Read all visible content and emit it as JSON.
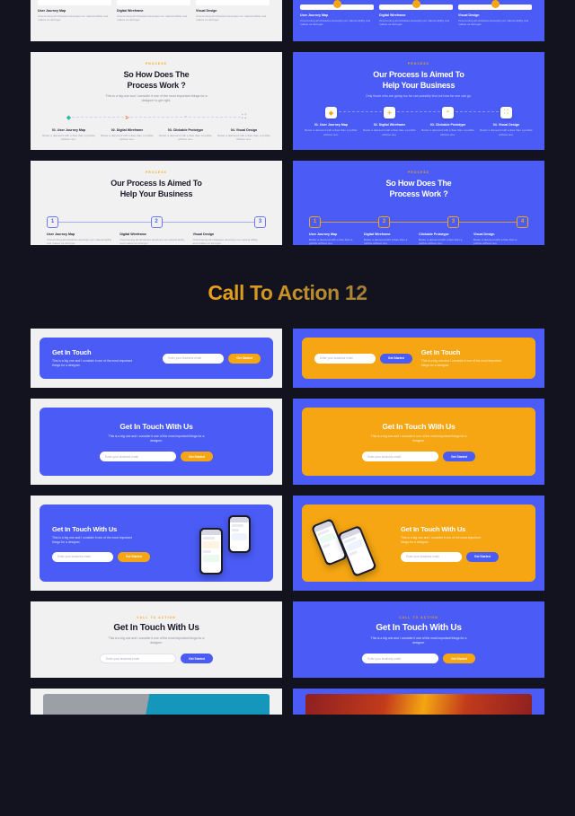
{
  "section": {
    "title": "Call To Action 12"
  },
  "partial_top": {
    "left": {
      "columns": [
        {
          "title": "User Journey Map",
          "desc": "Overcoming all obstacles develops our natural ability and makes us stronger."
        },
        {
          "title": "Digital Wireframe",
          "desc": "Overcoming all obstacles develops our natural ability and makes us stronger."
        },
        {
          "title": "Visual Design",
          "desc": "Overcoming all obstacles develops our natural ability and makes us stronger."
        }
      ]
    },
    "right": {
      "columns": [
        {
          "title": "User Journey Map",
          "desc": "Overcoming all obstacles develops our natural ability and makes us stronger."
        },
        {
          "title": "Digital Wireframe",
          "desc": "Overcoming all obstacles develops our natural ability and makes us stronger."
        },
        {
          "title": "Visual Design",
          "desc": "Overcoming all obstacles develops our natural ability and makes us stronger."
        }
      ]
    }
  },
  "process_row1": {
    "left": {
      "eyebrow": "PROCESS",
      "heading_line1": "So How Does The",
      "heading_line2": "Process Work ?",
      "subtitle": "This is a big one and I consider it one of the most important things for a designer to get right.",
      "steps": [
        {
          "icon": "gem-icon",
          "glyph": "♦",
          "color": "#2fb8a8",
          "title": "01. User Journey Map",
          "desc": "Better a diamond with a flaw than a pebble without one."
        },
        {
          "icon": "arrow-icon",
          "glyph": "➜",
          "color": "#f0723a",
          "title": "02. Digital Wireframe",
          "desc": "Better a diamond with a flaw than a pebble without one."
        },
        {
          "icon": "wifi-icon",
          "glyph": "◔",
          "color": "#4b8df6",
          "title": "03. Clickable Prototype",
          "desc": "Better a diamond with a flaw than a pebble without one."
        },
        {
          "icon": "expand-icon",
          "glyph": "⛶",
          "color": "#7a63f0",
          "title": "04. Visual Design",
          "desc": "Better a diamond with a flaw than a pebble without one."
        }
      ]
    },
    "right": {
      "eyebrow": "PROCESS",
      "heading_line1": "Our Process Is Aimed To",
      "heading_line2": "Help Your Business",
      "subtitle": "Only those who are going too far can possibly find out how far one can go.",
      "steps": [
        {
          "icon": "gem-icon",
          "glyph": "♦",
          "color": "#f5a612",
          "title": "01. User Journey Map",
          "desc": "Better a diamond with a flaw than a pebble without one."
        },
        {
          "icon": "bulb-icon",
          "glyph": "☀",
          "color": "#f5a612",
          "title": "02. Digital Wireframe",
          "desc": "Better a diamond with a flaw than a pebble without one."
        },
        {
          "icon": "wifi-icon",
          "glyph": "◔",
          "color": "#f5a612",
          "title": "03. Clickable Prototype",
          "desc": "Better a diamond with a flaw than a pebble without one."
        },
        {
          "icon": "expand-icon",
          "glyph": "⛶",
          "color": "#f5a612",
          "title": "04. Visual Design",
          "desc": "Better a diamond with a flaw than a pebble without one."
        }
      ]
    }
  },
  "process_row2": {
    "left": {
      "eyebrow": "PROCESS",
      "heading_line1": "Our Process Is Aimed To",
      "heading_line2": "Help Your Business",
      "steps": [
        {
          "number": "1",
          "title": "User Journey Map",
          "desc": "Overcoming all obstacles develops our natural ability and makes us stronger."
        },
        {
          "number": "2",
          "title": "Digital Wireframe",
          "desc": "Overcoming all obstacles develops our natural ability and makes us stronger."
        },
        {
          "number": "3",
          "title": "Visual Design",
          "desc": "Overcoming all obstacles develops our natural ability and makes us stronger."
        }
      ]
    },
    "right": {
      "eyebrow": "PROCESS",
      "heading_line1": "So How Does The",
      "heading_line2": "Process Work ?",
      "steps": [
        {
          "number": "1",
          "title": "User Journey Map",
          "desc": "Better a diamond with a flaw than a pebble without one."
        },
        {
          "number": "2",
          "title": "Digital Wireframe",
          "desc": "Better a diamond with a flaw than a pebble without one."
        },
        {
          "number": "3",
          "title": "Clickable Prototype",
          "desc": "Better a diamond with a flaw than a pebble without one."
        },
        {
          "number": "4",
          "title": "Visual Design",
          "desc": "Better a diamond with a flaw than a pebble without one."
        }
      ]
    }
  },
  "cta_row1": {
    "left": {
      "heading": "Get In Touch",
      "body": "This is a big one and I consider it one of the most important things for a designer.",
      "input_placeholder": "Enter your business email",
      "button_label": "Get Started"
    },
    "right": {
      "heading": "Get In Touch",
      "body": "This is a big one and I consider it one of the most important things for a designer.",
      "input_placeholder": "Enter your business email",
      "button_label": "Get Started"
    }
  },
  "cta_row2": {
    "left": {
      "heading": "Get In Touch With Us",
      "body": "This is a big one and I consider it one of the most important things for a designer.",
      "input_placeholder": "Enter your business email",
      "button_label": "Get Started"
    },
    "right": {
      "heading": "Get In Touch With Us",
      "body": "This is a big one and I consider it one of the most important things for a designer.",
      "input_placeholder": "Enter your business email",
      "button_label": "Get Started"
    }
  },
  "cta_row3": {
    "left": {
      "heading": "Get In Touch With Us",
      "body": "This is a big one and I consider it one of the most important things for a designer.",
      "input_placeholder": "Enter your business email",
      "button_label": "Get Started"
    },
    "right": {
      "heading": "Get In Touch With Us",
      "body": "This is a big one and I consider it one of the most important things for a designer.",
      "input_placeholder": "Enter your business email",
      "button_label": "Get Started"
    }
  },
  "cta_row4": {
    "left": {
      "eyebrow": "CALL TO ACTION",
      "heading": "Get In Touch With Us",
      "body": "This is a big one and I consider it one of the most important things for a designer.",
      "input_placeholder": "Enter your business email",
      "button_label": "Get Started"
    },
    "right": {
      "eyebrow": "CALL TO ACTION",
      "heading": "Get In Touch With Us",
      "body": "This is a big one and I consider it one of the most important things for a designer.",
      "input_placeholder": "Enter your business email",
      "button_label": "Get Started"
    }
  },
  "colors": {
    "background": "#13131f",
    "light_slide": "#f1f1f1",
    "brand_blue": "#4b5cf6",
    "brand_orange": "#f5a612",
    "heading_dark": "#1b1b2b"
  }
}
